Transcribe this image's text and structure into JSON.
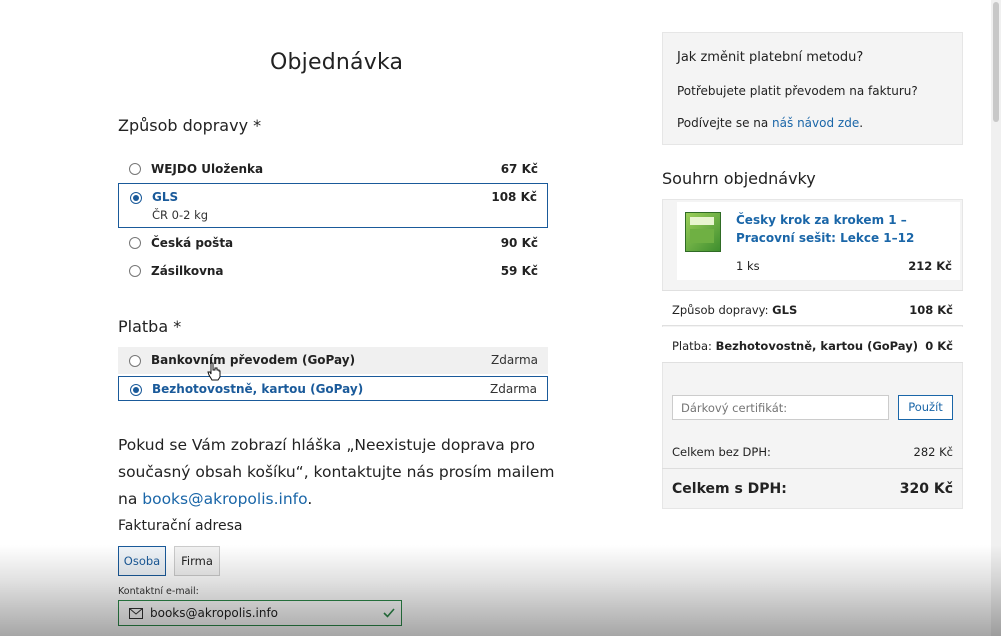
{
  "page": {
    "title": "Objednávka"
  },
  "shipping": {
    "heading": "Způsob dopravy *",
    "options": [
      {
        "name": "WEJDO Uloženka",
        "price": "67 Kč",
        "selected": false
      },
      {
        "name": "GLS",
        "sub": "ČR 0-2 kg",
        "price": "108 Kč",
        "selected": true
      },
      {
        "name": "Česká pošta",
        "price": "90 Kč",
        "selected": false
      },
      {
        "name": "Zásilkovna",
        "price": "59 Kč",
        "selected": false
      }
    ]
  },
  "payment": {
    "heading": "Platba *",
    "options": [
      {
        "name": "Bankovním převodem (GoPay)",
        "price": "Zdarma",
        "selected": false
      },
      {
        "name": "Bezhotovostně, kartou (GoPay)",
        "price": "Zdarma",
        "selected": true
      }
    ]
  },
  "notice": {
    "text_before": "Pokud se Vám zobrazí hláška „Neexistuje doprava pro současný obsah košíku“, kontaktujte nás prosím mailem na ",
    "email": "books@akropolis.info",
    "text_after": "."
  },
  "billing": {
    "heading": "Fakturační adresa",
    "tabs": [
      {
        "label": "Osoba",
        "active": true
      },
      {
        "label": "Firma",
        "active": false
      }
    ],
    "email_label": "Kontaktní e-mail:",
    "email_value": "books@akropolis.info"
  },
  "help": {
    "title": "Jak změnit platební metodu?",
    "line1": "Potřebujete platit převodem na fakturu?",
    "line2_before": "Podívejte se na ",
    "line2_link": "náš návod zde",
    "line2_after": "."
  },
  "summary": {
    "heading": "Souhrn objednávky",
    "product": {
      "name": "Česky krok za krokem 1 – Pracovní sešit: Lekce 1–12",
      "qty": "1 ks",
      "price": "212 Kč"
    },
    "shipping_label": "Způsob dopravy: ",
    "shipping_value": "GLS",
    "shipping_price": "108 Kč",
    "payment_label": "Platba: ",
    "payment_value": "Bezhotovostně, kartou (GoPay)",
    "payment_price": "0 Kč",
    "voucher_placeholder": "Dárkový certifikát:",
    "voucher_button": "Použít",
    "total_no_vat_label": "Celkem bez DPH:",
    "total_no_vat": "282 Kč",
    "total_label": "Celkem s DPH:",
    "total": "320 Kč"
  },
  "colors": {
    "accent": "#1a5a9a",
    "link": "#1a66a8",
    "valid": "#2d8a4a"
  }
}
